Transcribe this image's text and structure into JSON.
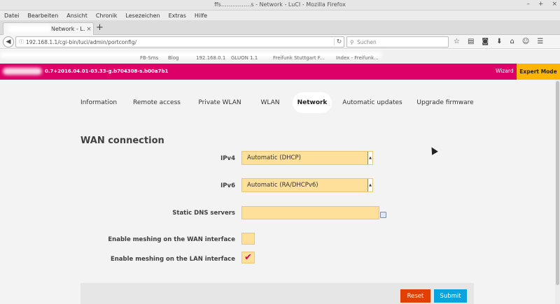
{
  "window": {
    "title": "ffs…………….s - Network - LuCI - Mozilla Firefox",
    "controls": [
      "–",
      "+",
      "×"
    ]
  },
  "menubar": [
    "Datei",
    "Bearbeiten",
    "Ansicht",
    "Chronik",
    "Lesezeichen",
    "Extras",
    "Hilfe"
  ],
  "tab": {
    "label": "Network - L…",
    "close": "×",
    "new_tab": "+"
  },
  "nav": {
    "url": "192.168.1.1/cgi-bin/luci/admin/portconfig/",
    "search_placeholder": "Suchen"
  },
  "bookmarks": [
    "FB-Sms",
    "Blog",
    "192.168.0.1",
    "GLUON 1.1",
    "Freifunk Stuttgart F...",
    "Index - Freifunk..."
  ],
  "header": {
    "version": "0.7+2016.04.01-03.33-g.b704308-s.b00a7b1",
    "wizard": "Wizard",
    "expert_mode": "Expert Mode"
  },
  "tabs": [
    {
      "label": "Information",
      "active": false
    },
    {
      "label": "Remote access",
      "active": false
    },
    {
      "label": "Private WLAN",
      "active": false
    },
    {
      "label": "WLAN",
      "active": false
    },
    {
      "label": "Network",
      "active": true
    },
    {
      "label": "Automatic updates",
      "active": false
    },
    {
      "label": "Upgrade firmware",
      "active": false
    }
  ],
  "section": {
    "title": "WAN connection"
  },
  "fields": {
    "ipv4": {
      "label": "IPv4",
      "value": "Automatic (DHCP)"
    },
    "ipv6": {
      "label": "IPv6",
      "value": "Automatic (RA/DHCPv6)"
    },
    "dns": {
      "label": "Static DNS servers",
      "value": ""
    },
    "mesh_wan": {
      "label": "Enable meshing on the WAN interface",
      "checked": false
    },
    "mesh_lan": {
      "label": "Enable meshing on the LAN interface",
      "checked": true
    }
  },
  "buttons": {
    "reset": "Reset",
    "submit": "Submit"
  },
  "colors": {
    "header": "#dc0067",
    "expert": "#ffb400",
    "field": "#ffe09a",
    "reset": "#e04000",
    "submit": "#0aa3e0",
    "check": "#d00063"
  }
}
